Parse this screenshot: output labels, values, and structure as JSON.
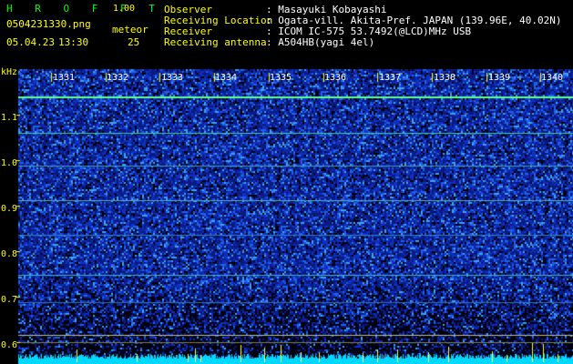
{
  "header": {
    "app_name": "H R O F F T",
    "app_version": "1.00",
    "filename": "0504231330.png",
    "meteor_label": "meteor",
    "date": "05.04.23",
    "time": "13:30",
    "meteor_count": "25"
  },
  "info": {
    "rows": [
      {
        "label": "Observer",
        "value": ": Masayuki Kobayashi"
      },
      {
        "label": "Receiving Location",
        "value": ": Ogata-vill. Akita-Pref. JAPAN (139.96E, 40.02N)"
      },
      {
        "label": "Receiver",
        "value": ": ICOM IC-575 53.7492(@LCD)MHz USB"
      },
      {
        "label": "Receiving antenna",
        "value": ": A504HB(yagi 4el)"
      }
    ]
  },
  "spectrogram": {
    "y_unit": "kHz",
    "y_ticks": [
      "1.1",
      "1.0",
      "0.9",
      "0.8",
      "0.7",
      "0.6"
    ],
    "x_ticks": [
      "1331",
      "1332",
      "1333",
      "1334",
      "1335",
      "1336",
      "1337",
      "1338",
      "1339",
      "1340"
    ],
    "colors": {
      "background": "#000000",
      "accent": "#ffff00",
      "signal": "#00ff80",
      "trace": "#00ffff"
    }
  }
}
